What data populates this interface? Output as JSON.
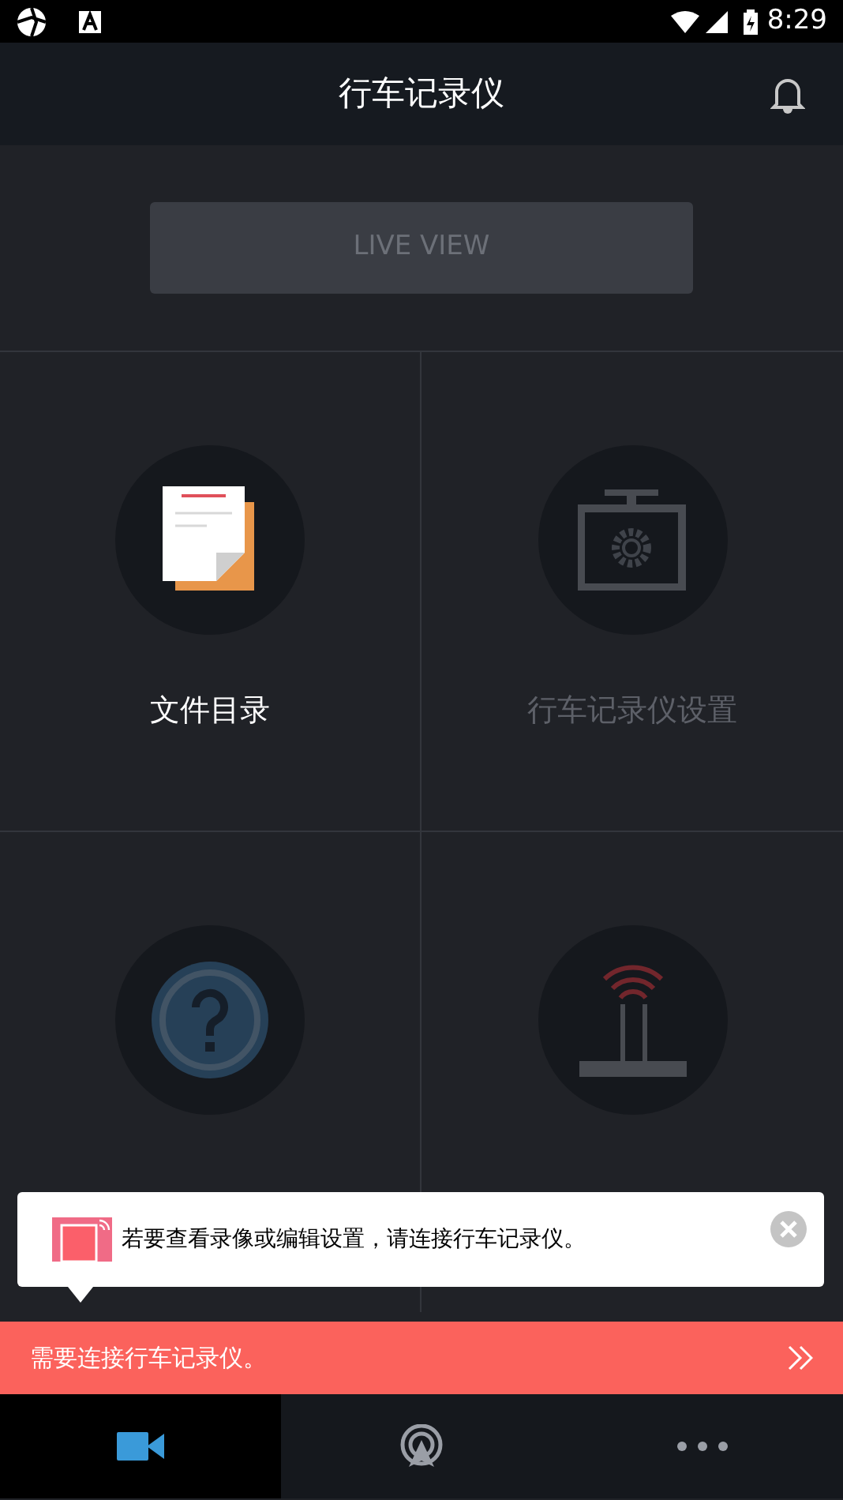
{
  "status_bar": {
    "time": "8:29"
  },
  "header": {
    "title": "行车记录仪"
  },
  "live_view": {
    "label": "LIVE VIEW",
    "disabled": true
  },
  "tiles": [
    {
      "kind": "files",
      "label": "文件目录",
      "disabled": false
    },
    {
      "kind": "camera-settings",
      "label": "行车记录仪设置",
      "disabled": true
    },
    {
      "kind": "info",
      "disabled": true
    },
    {
      "kind": "connection",
      "disabled": true
    }
  ],
  "popup": {
    "message": "若要查看录像或编辑设置，请连接行车记录仪。"
  },
  "alert_bar": {
    "message": "需要连接行车记录仪。"
  },
  "bottom_nav": [
    {
      "kind": "camera",
      "selected": true
    },
    {
      "kind": "broadcast",
      "selected": false
    },
    {
      "kind": "more",
      "selected": false
    }
  ]
}
